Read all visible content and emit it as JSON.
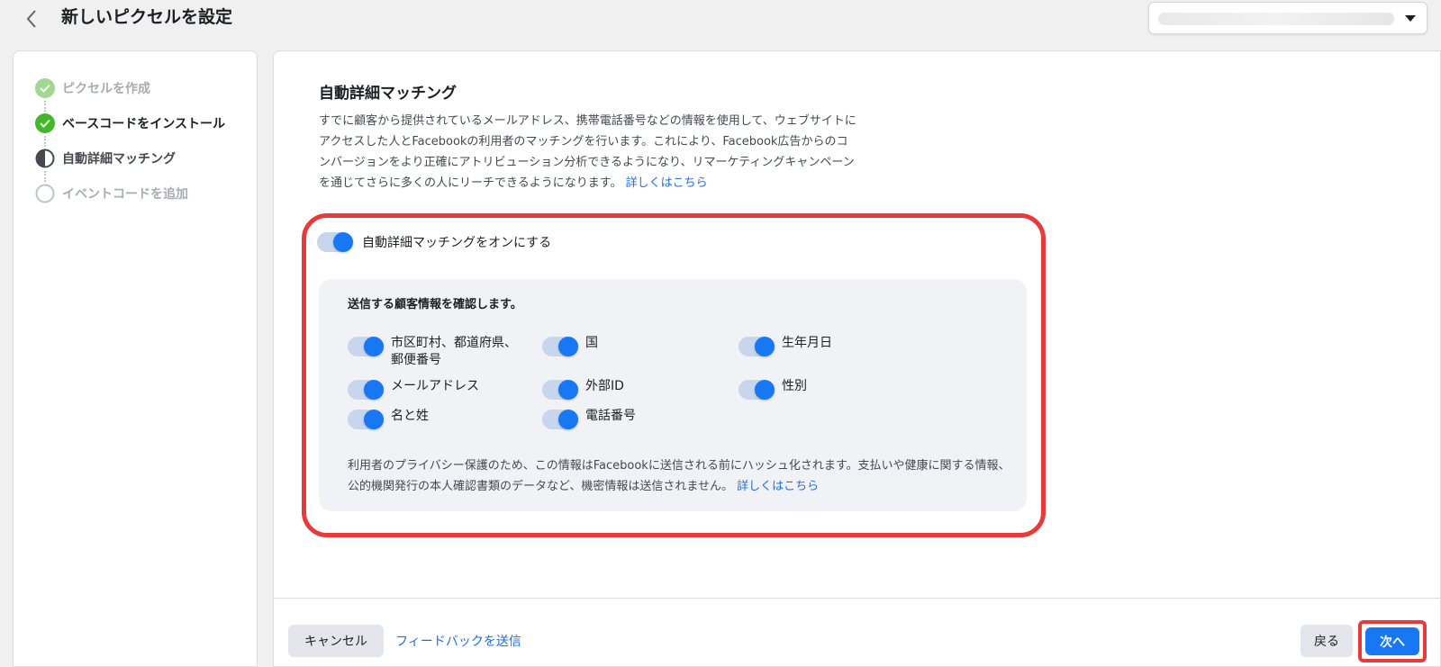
{
  "header": {
    "title": "新しいピクセルを設定"
  },
  "steps": [
    {
      "label": "ピクセルを作成",
      "state": "done-faded"
    },
    {
      "label": "ベースコードをインストール",
      "state": "done"
    },
    {
      "label": "自動詳細マッチング",
      "state": "current"
    },
    {
      "label": "イベントコードを追加",
      "state": "pending"
    }
  ],
  "main": {
    "title": "自動詳細マッチング",
    "description": "すでに顧客から提供されているメールアドレス、携帯電話番号などの情報を使用して、ウェブサイトにアクセスした人とFacebookの利用者のマッチングを行います。これにより、Facebook広告からのコンバージョンをより正確にアトリビューション分析できるようになり、リマーケティングキャンペーンを通じてさらに多くの人にリーチできるようになります。",
    "description_link": "詳しくはこちら",
    "toggle_label": "自動詳細マッチングをオンにする",
    "card": {
      "title": "送信する顧客情報を確認します。",
      "fields": [
        {
          "label": "市区町村、都道府県、郵便番号",
          "enabled": true
        },
        {
          "label": "国",
          "enabled": true
        },
        {
          "label": "生年月日",
          "enabled": true
        },
        {
          "label": "メールアドレス",
          "enabled": true
        },
        {
          "label": "外部ID",
          "enabled": true
        },
        {
          "label": "性別",
          "enabled": true
        },
        {
          "label": "名と姓",
          "enabled": true
        },
        {
          "label": "電話番号",
          "enabled": true
        }
      ],
      "note": "利用者のプライバシー保護のため、この情報はFacebookに送信される前にハッシュ化されます。支払いや健康に関する情報、公的機関発行の本人確認書類のデータなど、機密情報は送信されません。",
      "note_link": "詳しくはこちら"
    }
  },
  "footer": {
    "cancel": "キャンセル",
    "feedback": "フィードバックを送信",
    "back": "戻る",
    "next": "次へ"
  },
  "colors": {
    "accent": "#1877f2",
    "highlight": "#e83a3a",
    "done": "#42b72a"
  }
}
